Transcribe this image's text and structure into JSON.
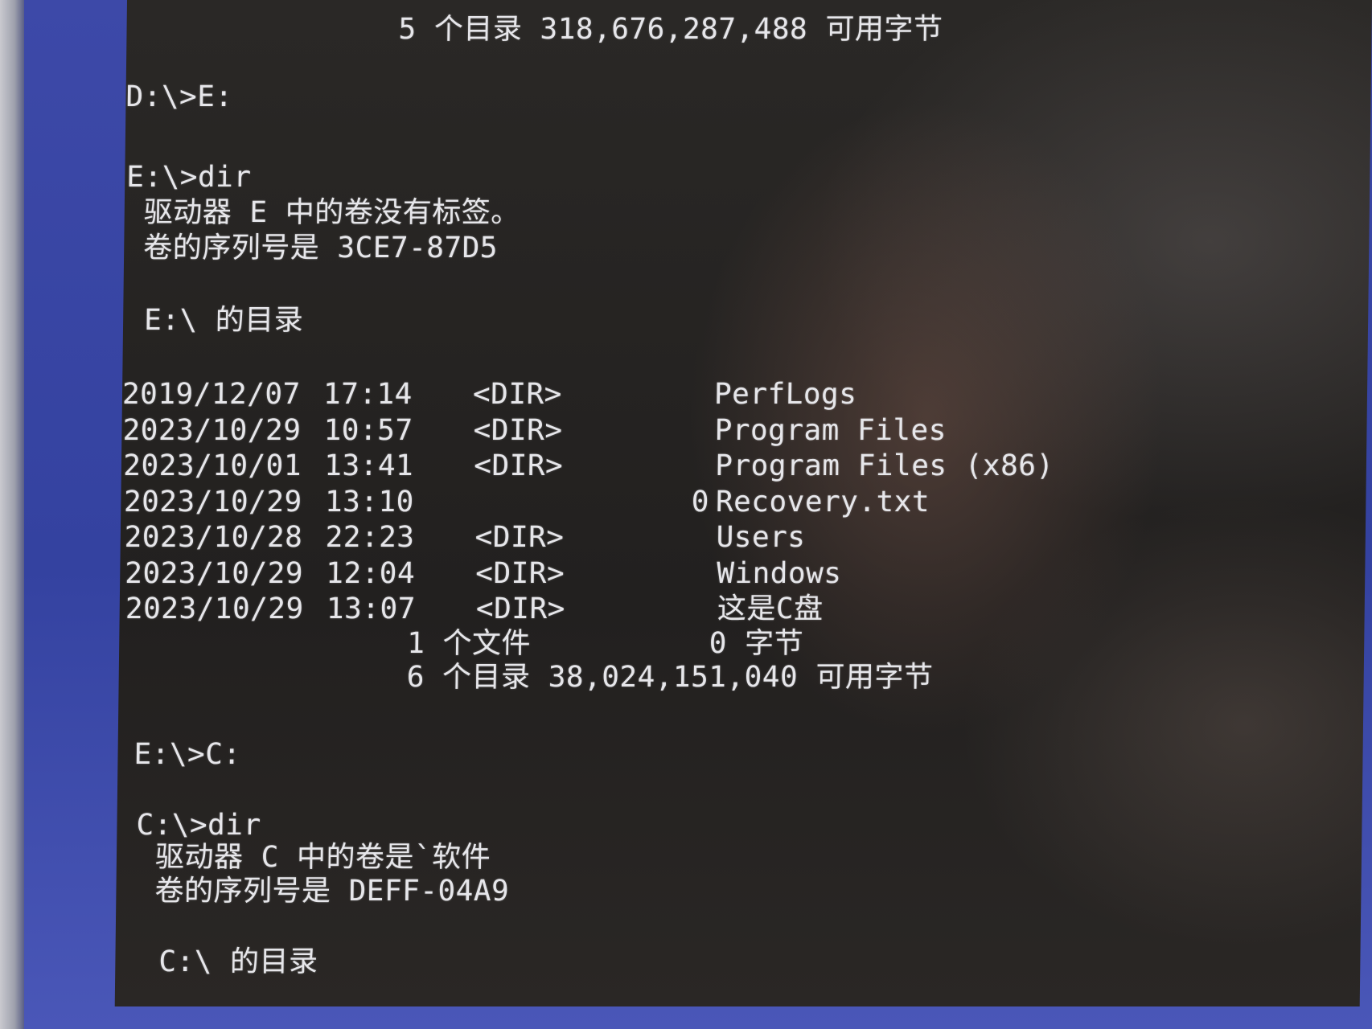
{
  "console": {
    "top_line": "5 个目录 318,676,287,488 可用字节",
    "cmd_switch_e": "D:\\>E:",
    "cmd_dir_e": "E:\\>dir",
    "e_volume_label": "驱动器 E 中的卷没有标签。",
    "e_serial": "卷的序列号是 3CE7-87D5",
    "e_dir_header": "E:\\ 的目录",
    "entries": [
      {
        "date": "2019/12/07",
        "time": "17:14",
        "type": "<DIR>",
        "size": "",
        "name": "PerfLogs"
      },
      {
        "date": "2023/10/29",
        "time": "10:57",
        "type": "<DIR>",
        "size": "",
        "name": "Program Files"
      },
      {
        "date": "2023/10/01",
        "time": "13:41",
        "type": "<DIR>",
        "size": "",
        "name": "Program Files (x86)"
      },
      {
        "date": "2023/10/29",
        "time": "13:10",
        "type": "",
        "size": "0",
        "name": "Recovery.txt"
      },
      {
        "date": "2023/10/28",
        "time": "22:23",
        "type": "<DIR>",
        "size": "",
        "name": "Users"
      },
      {
        "date": "2023/10/29",
        "time": "12:04",
        "type": "<DIR>",
        "size": "",
        "name": "Windows"
      },
      {
        "date": "2023/10/29",
        "time": "13:07",
        "type": "<DIR>",
        "size": "",
        "name": "这是C盘"
      }
    ],
    "summary_files": "1 个文件          0 字节",
    "summary_dirs": "6 个目录 38,024,151,040 可用字节",
    "cmd_switch_c": "E:\\>C:",
    "cmd_dir_c": "C:\\>dir",
    "c_volume_label": "驱动器 C 中的卷是`软件",
    "c_serial": "卷的序列号是 DEFF-04A9",
    "c_dir_header": "C:\\ 的目录"
  }
}
